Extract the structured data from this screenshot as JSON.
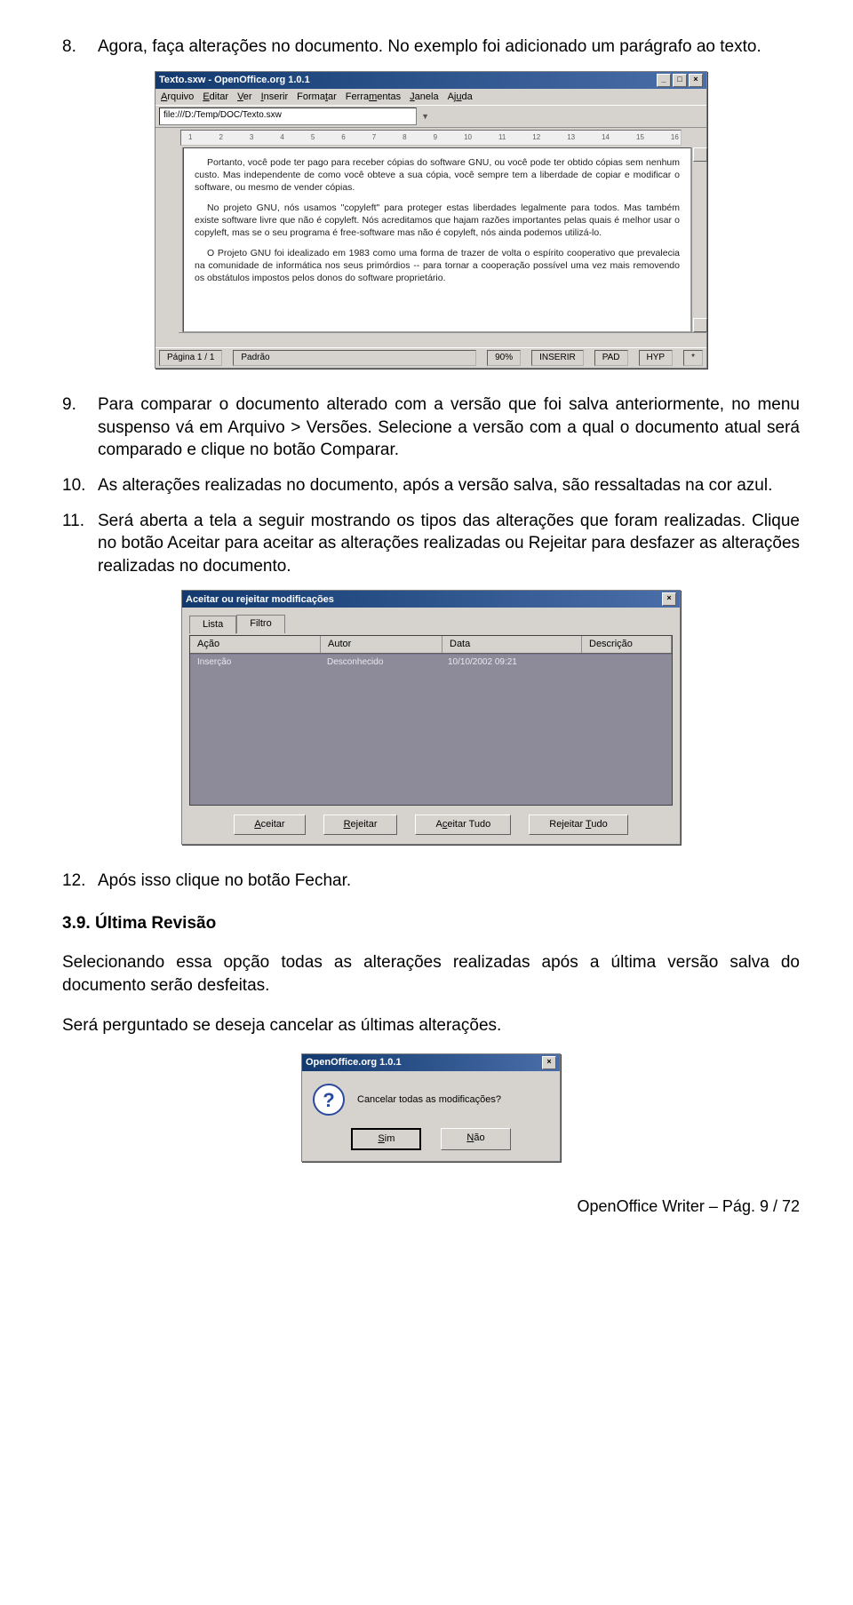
{
  "steps": {
    "s8": {
      "num": "8.",
      "text": "Agora, faça alterações no documento. No exemplo foi adicionado um parágrafo ao texto."
    },
    "s9": {
      "num": "9.",
      "text": "Para comparar o documento alterado com a versão que foi salva anteriormente, no menu suspenso vá em Arquivo > Versões. Selecione a versão com a qual o documento atual será comparado e clique no botão Comparar."
    },
    "s10": {
      "num": "10.",
      "text": "As alterações realizadas no documento, após a versão salva, são ressaltadas na cor azul."
    },
    "s11": {
      "num": "11.",
      "text": "Será aberta a tela a seguir mostrando os tipos das alterações que foram realizadas. Clique no botão Aceitar para aceitar as alterações realizadas ou Rejeitar para desfazer as alterações realizadas no documento."
    },
    "s12": {
      "num": "12.",
      "text": "Após isso clique no botão Fechar."
    }
  },
  "appwin": {
    "title": "Texto.sxw - OpenOffice.org 1.0.1",
    "menus": [
      "Arquivo",
      "Editar",
      "Ver",
      "Inserir",
      "Formatar",
      "Ferramentas",
      "Janela",
      "Ajuda"
    ],
    "url": "file:///D:/Temp/DOC/Texto.sxw",
    "ruler": [
      "1",
      "2",
      "3",
      "4",
      "5",
      "6",
      "7",
      "8",
      "9",
      "10",
      "11",
      "12",
      "13",
      "14",
      "15",
      "16"
    ],
    "para1": "Portanto, você pode ter pago para receber cópias do software GNU, ou você pode ter obtido cópias sem nenhum custo. Mas independente de como você obteve a sua cópia, você sempre tem a liberdade de copiar e modificar o software, ou mesmo de vender cópias.",
    "para2": "No projeto GNU, nós usamos \"copyleft\" para proteger estas liberdades legalmente para todos. Mas também existe software livre que não é copyleft. Nós acreditamos que hajam razões importantes pelas quais é melhor usar o copyleft, mas se o seu programa é free-software mas não é copyleft, nós ainda podemos utilizá-lo.",
    "para3": "O Projeto GNU foi idealizado em 1983 como uma forma de trazer de volta o espírito cooperativo que prevalecia na comunidade de informática nos seus primórdios -- para tornar a cooperação possível uma vez mais removendo os obstátulos impostos pelos donos do software proprietário.",
    "status": {
      "page": "Página 1 / 1",
      "style": "Padrão",
      "zoom": "90%",
      "ins": "INSERIR",
      "pad": "PAD",
      "hyp": "HYP",
      "star": "*"
    }
  },
  "dialog": {
    "title": "Aceitar ou rejeitar modificações",
    "tabs": {
      "list": "Lista",
      "filter": "Filtro"
    },
    "headers": {
      "action": "Ação",
      "author": "Autor",
      "date": "Data",
      "desc": "Descrição"
    },
    "row": {
      "action": "Inserção",
      "author": "Desconhecido",
      "date": "10/10/2002 09:21",
      "desc": ""
    },
    "buttons": {
      "accept": "Aceitar",
      "reject": "Rejeitar",
      "accept_all": "Aceitar Tudo",
      "reject_all": "Rejeitar Tudo"
    }
  },
  "section": {
    "num": "3.9.",
    "title": "Última Revisão",
    "p1": "Selecionando essa opção todas as alterações realizadas após a última versão salva do documento serão desfeitas.",
    "p2": "Será perguntado se deseja cancelar as últimas alterações."
  },
  "msgbox": {
    "title": "OpenOffice.org 1.0.1",
    "text": "Cancelar todas as modificações?",
    "yes": "Sim",
    "no": "Não"
  },
  "footer": "OpenOffice Writer – Pág. 9 / 72"
}
